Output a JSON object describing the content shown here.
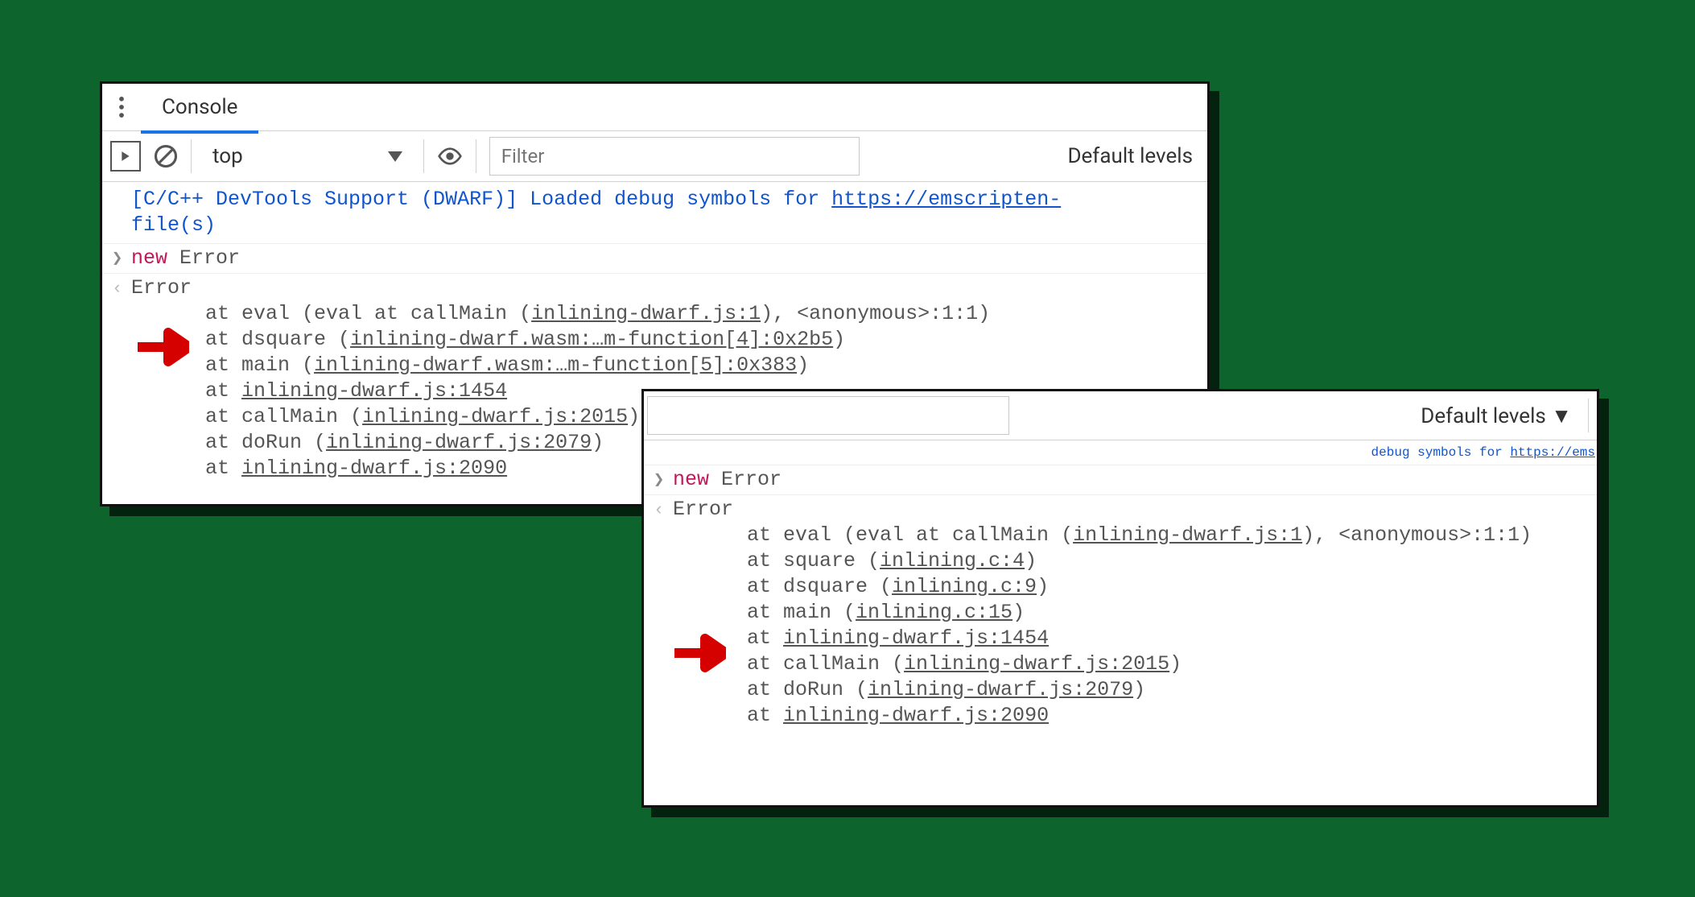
{
  "panel1": {
    "tab_label": "Console",
    "context": "top",
    "filter_placeholder": "Filter",
    "levels_label": "Default levels",
    "info_prefix": "[C/C++ DevTools Support (DWARF)] Loaded debug symbols for ",
    "info_link": "https://emscripten-",
    "info_suffix": "file(s)",
    "input_new": "new",
    "input_err": " Error",
    "error_header": "Error",
    "trace": [
      {
        "pre": "at eval (eval at callMain (",
        "link": "inlining-dwarf.js:1",
        "post": "), <anonymous>:1:1)"
      },
      {
        "pre": "at dsquare (",
        "link": "inlining-dwarf.wasm:…m-function[4]:0x2b5",
        "post": ")"
      },
      {
        "pre": "at main (",
        "link": "inlining-dwarf.wasm:…m-function[5]:0x383",
        "post": ")"
      },
      {
        "pre": "at ",
        "link": "inlining-dwarf.js:1454",
        "post": ""
      },
      {
        "pre": "at callMain (",
        "link": "inlining-dwarf.js:2015",
        "post": ")"
      },
      {
        "pre": "at doRun (",
        "link": "inlining-dwarf.js:2079",
        "post": ")"
      },
      {
        "pre": "at ",
        "link": "inlining-dwarf.js:2090",
        "post": ""
      }
    ]
  },
  "panel2": {
    "levels_label": "Default levels ▼",
    "info_prefix": "debug symbols for ",
    "info_link": "https://ems",
    "input_new": "new",
    "input_err": " Error",
    "error_header": "Error",
    "trace": [
      {
        "pre": "at eval (eval at callMain (",
        "link": "inlining-dwarf.js:1",
        "post": "), <anonymous>:1:1)"
      },
      {
        "pre": "at square (",
        "link": "inlining.c:4",
        "post": ")"
      },
      {
        "pre": "at dsquare (",
        "link": "inlining.c:9",
        "post": ")"
      },
      {
        "pre": "at main (",
        "link": "inlining.c:15",
        "post": ")"
      },
      {
        "pre": "at ",
        "link": "inlining-dwarf.js:1454",
        "post": ""
      },
      {
        "pre": "at callMain (",
        "link": "inlining-dwarf.js:2015",
        "post": ")"
      },
      {
        "pre": "at doRun (",
        "link": "inlining-dwarf.js:2079",
        "post": ")"
      },
      {
        "pre": "at ",
        "link": "inlining-dwarf.js:2090",
        "post": ""
      }
    ]
  }
}
